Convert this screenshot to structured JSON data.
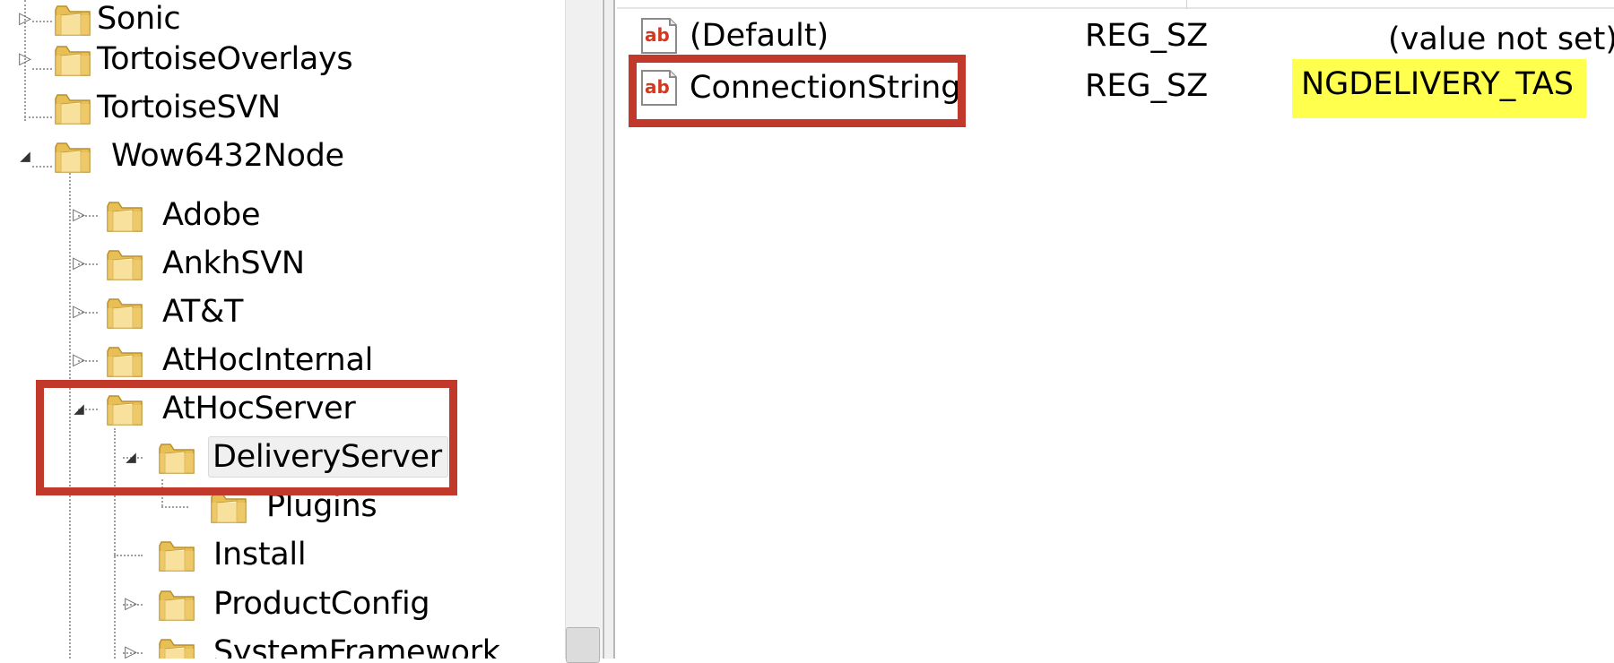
{
  "tree": {
    "nodes": [
      {
        "id": "sonic",
        "label": "Sonic",
        "expander": "collapsed"
      },
      {
        "id": "tortoiseoverlays",
        "label": "TortoiseOverlays",
        "expander": "collapsed"
      },
      {
        "id": "tortoisesvn",
        "label": "TortoiseSVN",
        "expander": "none"
      },
      {
        "id": "wow6432node",
        "label": "Wow6432Node",
        "expander": "expanded"
      },
      {
        "id": "adobe",
        "label": "Adobe",
        "expander": "collapsed"
      },
      {
        "id": "ankhsvn",
        "label": "AnkhSVN",
        "expander": "collapsed"
      },
      {
        "id": "att",
        "label": "AT&T",
        "expander": "collapsed"
      },
      {
        "id": "athocinternal",
        "label": "AtHocInternal",
        "expander": "collapsed"
      },
      {
        "id": "athocserver",
        "label": "AtHocServer",
        "expander": "expanded"
      },
      {
        "id": "deliveryserver",
        "label": "DeliveryServer",
        "expander": "expanded",
        "selected": true
      },
      {
        "id": "plugins",
        "label": "Plugins",
        "expander": "none"
      },
      {
        "id": "install",
        "label": "Install",
        "expander": "none"
      },
      {
        "id": "productconfig",
        "label": "ProductConfig",
        "expander": "collapsed"
      },
      {
        "id": "systemframework",
        "label": "SystemFramework",
        "expander": "collapsed"
      }
    ],
    "glyphs": {
      "collapsed": "▷",
      "expanded": "◢"
    }
  },
  "values": {
    "rows": [
      {
        "icon": "string-value-icon",
        "name": "(Default)",
        "type": "REG_SZ",
        "data": "(value not set)"
      },
      {
        "icon": "string-value-icon",
        "name": "ConnectionString",
        "type": "REG_SZ",
        "data": "NGDELIVERY_TAS"
      }
    ],
    "icon_text": "ab"
  },
  "colors": {
    "annotation_red": "#c0392b",
    "highlight_yellow": "#ffff4d",
    "folder_yellow": "#f3d27a"
  }
}
